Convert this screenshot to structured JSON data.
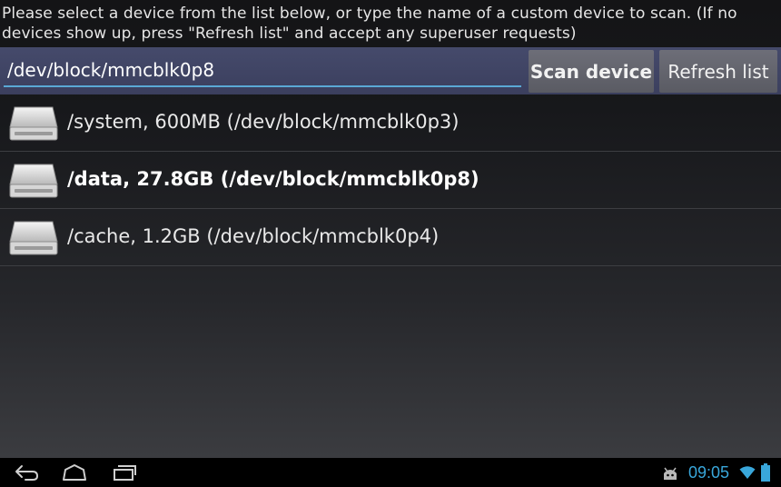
{
  "instructions": "Please select a device from the list below, or type the name of a custom device to scan. (If no devices show up, press \"Refresh list\" and accept any superuser requests)",
  "input": {
    "value": "/dev/block/mmcblk0p8"
  },
  "buttons": {
    "scan": "Scan device",
    "refresh": "Refresh list"
  },
  "devices": [
    {
      "label": "/system, 600MB (/dev/block/mmcblk0p3)",
      "icon": "drive-icon",
      "selected": false
    },
    {
      "label": "/data, 27.8GB (/dev/block/mmcblk0p8)",
      "icon": "drive-icon",
      "selected": true
    },
    {
      "label": "/cache, 1.2GB (/dev/block/mmcblk0p4)",
      "icon": "drive-icon",
      "selected": false
    }
  ],
  "statusbar": {
    "time": "09:05",
    "icons": [
      "back-icon",
      "home-icon",
      "recent-apps-icon",
      "android-debug-icon",
      "wifi-icon",
      "battery-icon"
    ]
  },
  "colors": {
    "accent": "#39a7db",
    "input_bar": "#454a6b",
    "button": "#66676f"
  }
}
